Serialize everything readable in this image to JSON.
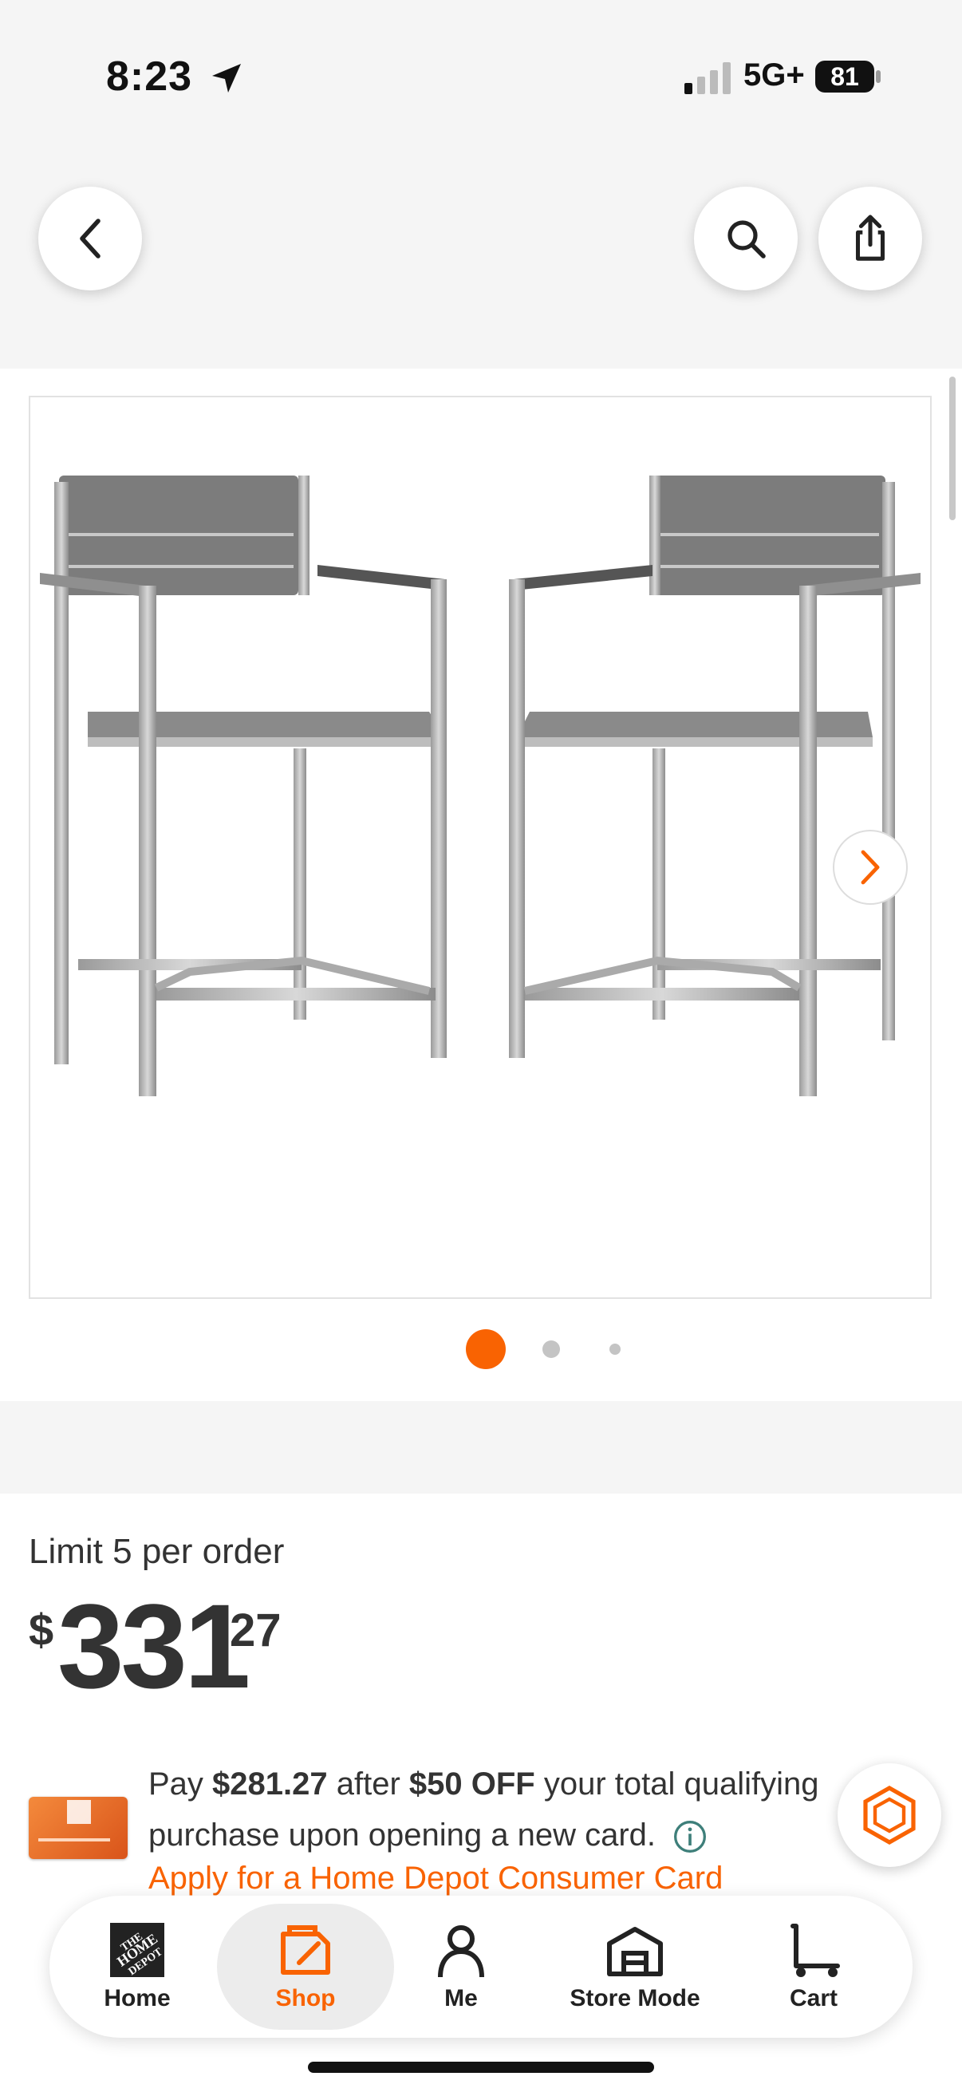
{
  "status_bar": {
    "time": "8:23",
    "network": "5G+",
    "battery": "81"
  },
  "header": {
    "back_icon": "chevron-left-icon",
    "search_icon": "search-icon",
    "share_icon": "share-icon"
  },
  "gallery": {
    "image_description_icon": "product-image",
    "next_icon": "chevron-right-icon",
    "active_index": 0,
    "dot_count": 3
  },
  "product": {
    "limit_text": "Limit 5 per order",
    "price_symbol": "$",
    "price_dollars": "331",
    "price_cents": "27"
  },
  "promo": {
    "pay": "Pay ",
    "amount": "$281.27",
    "after": " after ",
    "off": "$50 OFF",
    "rest1": " your total qualifying",
    "line2": "purchase upon opening a new card.",
    "apply_link": "Apply for a Home Depot Consumer Card"
  },
  "nav": {
    "items": [
      {
        "label": "Home"
      },
      {
        "label": "Shop"
      },
      {
        "label": "Me"
      },
      {
        "label": "Store Mode"
      },
      {
        "label": "Cart"
      }
    ],
    "active": "Shop"
  },
  "colors": {
    "accent": "#f96302",
    "background": "#f5f5f5"
  }
}
